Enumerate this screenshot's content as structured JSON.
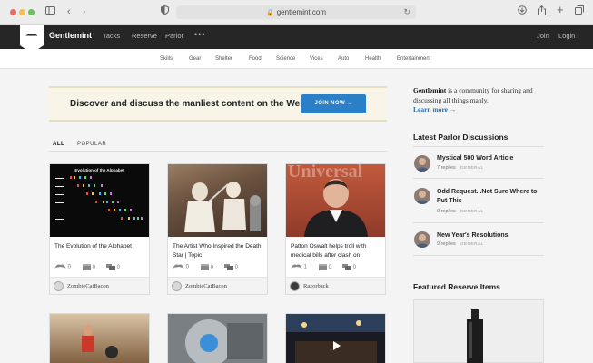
{
  "browser": {
    "url": "gentlemint.com"
  },
  "site": {
    "brand": "Gentlemint",
    "nav": [
      "Tacks",
      "Reserve",
      "Parlor"
    ],
    "more": "•••",
    "join": "Join",
    "login": "Login",
    "categories": [
      "Skills",
      "Gear",
      "Shelter",
      "Food",
      "Science",
      "Vices",
      "Auto",
      "Health",
      "Entertainment"
    ]
  },
  "hero": {
    "text": "Discover and discuss the manliest content on the Web",
    "button": "JOIN NOW →"
  },
  "feed": {
    "tabs": [
      "ALL",
      "POPULAR"
    ],
    "cards": [
      {
        "title": "The Evolution of the Alphabet",
        "thumb_title": "Evolution of the Alphabet",
        "likes": "0",
        "saves": "0",
        "comments": "0",
        "author": "ZombieCatBacon"
      },
      {
        "title": "The Artist Who Inspired the Death Star | Topic",
        "likes": "0",
        "saves": "0",
        "comments": "0",
        "author": "ZombieCatBacon"
      },
      {
        "title": "Patton Oswalt helps troll with medical bills after clash on",
        "thumb_text": "Universal",
        "likes": "1",
        "saves": "0",
        "comments": "0",
        "author": "Razorback"
      }
    ]
  },
  "sidebar": {
    "about_brand": "Gentlemint",
    "about_text": " is a community for sharing and discussing all things manly.",
    "learn_more": "Learn more →",
    "parlor_head": "Latest Parlor Discussions",
    "discussions": [
      {
        "title": "Mystical 500 Word Article",
        "replies": "7 replies",
        "tag": "GENERAL"
      },
      {
        "title": "Odd Request...Not Sure Where to Put This",
        "replies": "9 replies",
        "tag": "GENERAL"
      },
      {
        "title": "New Year's Resolutions",
        "replies": "9 replies",
        "tag": "GENERAL"
      }
    ],
    "featured_head": "Featured Reserve Items"
  }
}
